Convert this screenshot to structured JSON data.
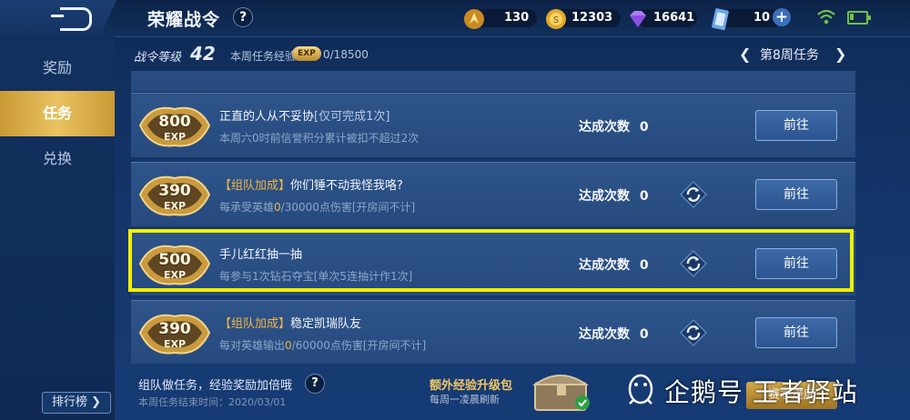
{
  "header": {
    "title": "荣耀战令",
    "help": "?",
    "resources": [
      {
        "icon": "honor-token-icon",
        "value": "130"
      },
      {
        "icon": "gold-coin-icon",
        "value": "12303"
      },
      {
        "icon": "diamond-icon",
        "value": "16641"
      },
      {
        "icon": "voucher-card-icon",
        "value": "10"
      }
    ],
    "add": "+"
  },
  "sidebar": {
    "items": [
      {
        "label": "奖励"
      },
      {
        "label": "任务"
      },
      {
        "label": "兑换"
      }
    ],
    "rank_button": "排行榜 ❯"
  },
  "progress": {
    "level_label": "战令等级",
    "level": "42",
    "week_exp_label": "本周任务经验",
    "exp_badge": "EXP",
    "week_exp": "0/18500"
  },
  "week_nav": {
    "prev": "❮",
    "label": "第8周任务",
    "next": "❯"
  },
  "tasks": [
    {
      "exp": "800",
      "exp_unit": "EXP",
      "tag": "",
      "name": "正直的人从不妥协",
      "name_suffix": "[仅可完成1次]",
      "desc_pre": "本周六0时前信誉积分累计被扣不超过2次",
      "desc_hl": "",
      "desc_post": "",
      "count_label": "达成次数",
      "count": "0",
      "refresh": false,
      "go": "前往"
    },
    {
      "exp": "390",
      "exp_unit": "EXP",
      "tag": "【组队加成】",
      "name": "你们锤不动我怪我咯?",
      "name_suffix": "",
      "desc_pre": "每承受英雄",
      "desc_hl": "0",
      "desc_post": "/30000点伤害[开房间不计]",
      "count_label": "达成次数",
      "count": "0",
      "refresh": true,
      "go": "前往"
    },
    {
      "exp": "500",
      "exp_unit": "EXP",
      "tag": "",
      "name": "手儿红红抽一抽",
      "name_suffix": "",
      "desc_pre": "每参与1次钻石夺宝[单次5连抽计作1次]",
      "desc_hl": "",
      "desc_post": "",
      "count_label": "达成次数",
      "count": "0",
      "refresh": true,
      "go": "前往"
    },
    {
      "exp": "390",
      "exp_unit": "EXP",
      "tag": "【组队加成】",
      "name": "稳定凯瑞队友",
      "name_suffix": "",
      "desc_pre": "每对英雄输出",
      "desc_hl": "0",
      "desc_post": "/60000点伤害[开房间不计]",
      "count_label": "达成次数",
      "count": "0",
      "refresh": true,
      "go": "前往"
    }
  ],
  "footer": {
    "hint": "组队做任务，经验奖励加倍哦",
    "help": "?",
    "end_time": "本周任务结束时间：2020/03/01",
    "pack_title": "额外经验升级包",
    "pack_sub": "每周一凌晨刷新",
    "season_button": "赛季进度",
    "watermark": "企鹅号 王者驿站"
  },
  "colors": {
    "accent_gold": "#e9c261",
    "highlight": "#f0f000",
    "tag": "#f0b445"
  }
}
